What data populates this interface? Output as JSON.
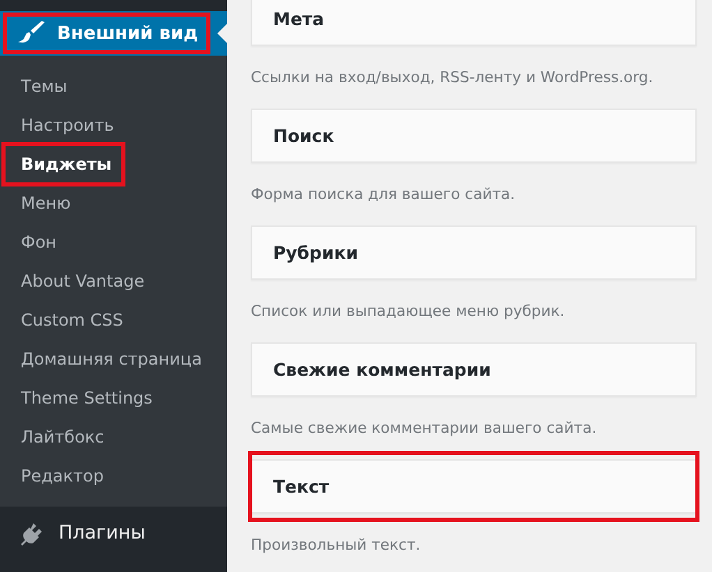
{
  "sidebar": {
    "current": {
      "label": "Внешний вид",
      "highlighted": true
    },
    "submenu": [
      {
        "label": "Темы",
        "selected": false,
        "highlighted": false
      },
      {
        "label": "Настроить",
        "selected": false,
        "highlighted": false
      },
      {
        "label": "Виджеты",
        "selected": true,
        "highlighted": true
      },
      {
        "label": "Меню",
        "selected": false,
        "highlighted": false
      },
      {
        "label": "Фон",
        "selected": false,
        "highlighted": false
      },
      {
        "label": "About Vantage",
        "selected": false,
        "highlighted": false
      },
      {
        "label": "Custom CSS",
        "selected": false,
        "highlighted": false
      },
      {
        "label": "Домашняя страница",
        "selected": false,
        "highlighted": false
      },
      {
        "label": "Theme Settings",
        "selected": false,
        "highlighted": false
      },
      {
        "label": "Лайтбокс",
        "selected": false,
        "highlighted": false
      },
      {
        "label": "Редактор",
        "selected": false,
        "highlighted": false
      }
    ],
    "items": [
      {
        "label": "Плагины"
      }
    ]
  },
  "widgets": [
    {
      "title": "Мета",
      "description": "Ссылки на вход/выход, RSS-ленту и WordPress.org.",
      "highlighted": false
    },
    {
      "title": "Поиск",
      "description": "Форма поиска для вашего сайта.",
      "highlighted": false
    },
    {
      "title": "Рубрики",
      "description": "Список или выпадающее меню рубрик.",
      "highlighted": false
    },
    {
      "title": "Свежие комментарии",
      "description": "Самые свежие комментарии вашего сайта.",
      "highlighted": false
    },
    {
      "title": "Текст",
      "description": "Произвольный текст.",
      "highlighted": true
    }
  ]
}
